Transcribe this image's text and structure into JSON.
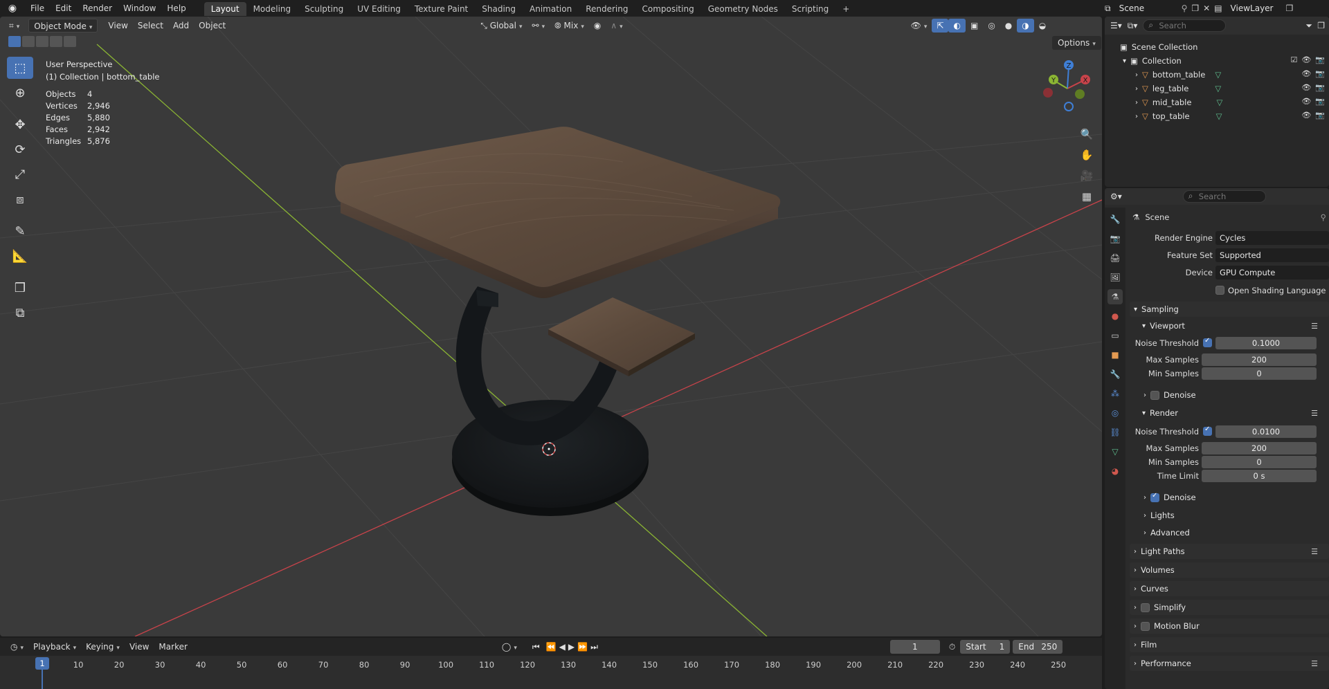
{
  "menu": [
    "File",
    "Edit",
    "Render",
    "Window",
    "Help"
  ],
  "workspaces": [
    "Layout",
    "Modeling",
    "Sculpting",
    "UV Editing",
    "Texture Paint",
    "Shading",
    "Animation",
    "Rendering",
    "Compositing",
    "Geometry Nodes",
    "Scripting"
  ],
  "active_workspace": "Layout",
  "top_right": {
    "scene": "Scene",
    "view_layer": "ViewLayer"
  },
  "viewport": {
    "mode": "Object Mode",
    "header_menus": [
      "View",
      "Select",
      "Add",
      "Object"
    ],
    "transform_orientation": "Global",
    "snap_mode": "Mix",
    "options_label": "Options",
    "perspective": "User Perspective",
    "context": "(1) Collection | bottom_table",
    "stats": [
      {
        "label": "Objects",
        "value": "4"
      },
      {
        "label": "Vertices",
        "value": "2,946"
      },
      {
        "label": "Edges",
        "value": "5,880"
      },
      {
        "label": "Faces",
        "value": "2,942"
      },
      {
        "label": "Triangles",
        "value": "5,876"
      }
    ],
    "gizmo_axes": [
      "X",
      "Y",
      "Z"
    ],
    "colors": {
      "x_axis": "#c8434a",
      "y_axis": "#8bb533",
      "z_axis": "#3f7fd6",
      "accent": "#4772b3"
    }
  },
  "outliner": {
    "search_placeholder": "Search",
    "scene_collection": "Scene Collection",
    "collection": "Collection",
    "objects": [
      "bottom_table",
      "leg_table",
      "mid_table",
      "top_table"
    ]
  },
  "properties": {
    "search_placeholder": "Search",
    "context": "Scene",
    "render_engine_label": "Render Engine",
    "render_engine": "Cycles",
    "feature_set_label": "Feature Set",
    "feature_set": "Supported",
    "device_label": "Device",
    "device": "GPU Compute",
    "osl_label": "Open Shading Language",
    "sampling": "Sampling",
    "viewport_section": "Viewport",
    "vp_noise_threshold_label": "Noise Threshold",
    "vp_noise_threshold": "0.1000",
    "vp_max_samples_label": "Max Samples",
    "vp_max_samples": "200",
    "vp_min_samples_label": "Min Samples",
    "vp_min_samples": "0",
    "vp_denoise": "Denoise",
    "render_section": "Render",
    "r_noise_threshold_label": "Noise Threshold",
    "r_noise_threshold": "0.0100",
    "r_max_samples_label": "Max Samples",
    "r_max_samples": "200",
    "r_min_samples_label": "Min Samples",
    "r_min_samples": "0",
    "r_time_limit_label": "Time Limit",
    "r_time_limit": "0 s",
    "r_denoise": "Denoise",
    "lights": "Lights",
    "advanced": "Advanced",
    "sections": [
      "Light Paths",
      "Volumes",
      "Curves",
      "Simplify",
      "Motion Blur",
      "Film",
      "Performance"
    ]
  },
  "timeline": {
    "menus": [
      "Playback",
      "Keying",
      "View",
      "Marker"
    ],
    "current_frame": "1",
    "start_label": "Start",
    "start": "1",
    "end_label": "End",
    "end": "250",
    "ticks": [
      "10",
      "20",
      "30",
      "40",
      "50",
      "60",
      "70",
      "80",
      "90",
      "100",
      "110",
      "120",
      "130",
      "140",
      "150",
      "160",
      "170",
      "180",
      "190",
      "200",
      "210",
      "220",
      "230",
      "240",
      "250"
    ]
  }
}
